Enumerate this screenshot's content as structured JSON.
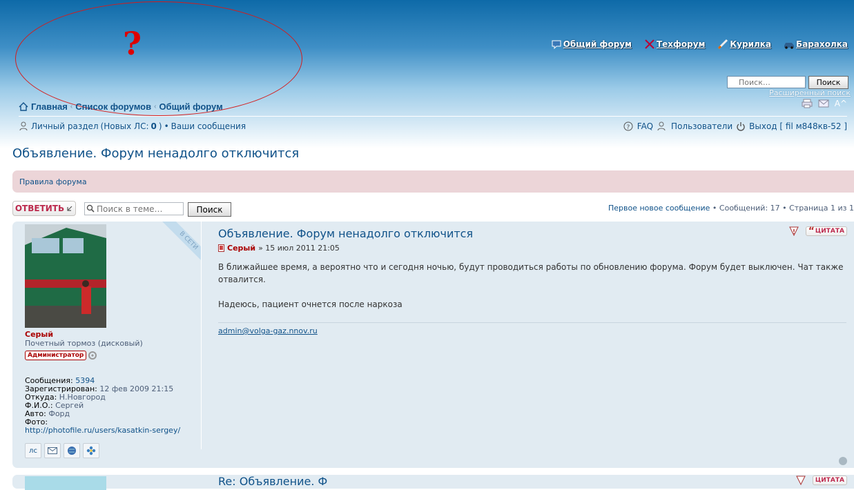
{
  "header": {
    "logo_mark": "?",
    "site_nav": [
      {
        "label": "Общий форум",
        "icon": "forum-icon"
      },
      {
        "label": "Техфорум",
        "icon": "tools-icon"
      },
      {
        "label": "Курилка",
        "icon": "cigarette-icon"
      },
      {
        "label": "Барахолка",
        "icon": "car-icon"
      }
    ],
    "search_placeholder": "Поиск…",
    "search_button": "Поиск",
    "advanced_search": "Расширенный поиск",
    "font_resize": "A^"
  },
  "breadcrumb": {
    "home": "Главная",
    "forums": "Список форумов",
    "current": "Общий форум",
    "separator": "‹"
  },
  "user_bar": {
    "private_section": "Личный раздел",
    "new_pm_prefix": "(Новых ЛС:",
    "new_pm_count": "0",
    "new_pm_suffix": ")",
    "bullet": "•",
    "your_posts": "Ваши сообщения",
    "faq": "FAQ",
    "members": "Пользователи",
    "logout": "Выход [ fil м848кв-52 ]"
  },
  "topic": {
    "title": "Объявление. Форум ненадолго отключится",
    "rules_link": "Правила форума",
    "reply_button": "ОТВЕТИТЬ",
    "search_placeholder": "Поиск в теме…",
    "search_button": "Поиск",
    "first_unread": "Первое новое сообщение",
    "stats": "• Сообщений: 17 • Страница 1 из 1"
  },
  "post": {
    "title": "Объявление. Форум ненадолго отключится",
    "author": "Серый",
    "date": "» 15 июл 2011 21:05",
    "paragraph1": "В ближайшее время, а вероятно что и сегодня ночью, будут проводиться работы по обновлению форума. Форум будет выключен. Чат также отвалится.",
    "paragraph2": "Надеюсь, пациент очнется после наркоза",
    "signature": "admin@volga-gaz.nnov.ru",
    "quote_button": "ЦИТАТА",
    "online_label": "В СЕТИ",
    "profile": {
      "name": "Серый",
      "rank": "Почетный тормоз (дисковый)",
      "badge": "Администратор",
      "posts_label": "Сообщения:",
      "posts_value": "5394",
      "registered_label": "Зарегистрирован:",
      "registered_value": "12 фев 2009 21:15",
      "from_label": "Откуда:",
      "from_value": "Н.Новгород",
      "fio_label": "Ф.И.О.:",
      "fio_value": "Сергей",
      "auto_label": "Авто:",
      "auto_value": "Форд",
      "photo_label": "Фото:",
      "photo_link": "http://photofile.ru/users/kasatkin-sergey/",
      "pm_label": "лс"
    }
  },
  "post2": {
    "title_partial": "Re: Объявление. Ф"
  },
  "colors": {
    "link": "#105289",
    "author": "#aa0000",
    "post_bg": "#e1ebf2",
    "rules_bg": "#ecd5d8"
  }
}
